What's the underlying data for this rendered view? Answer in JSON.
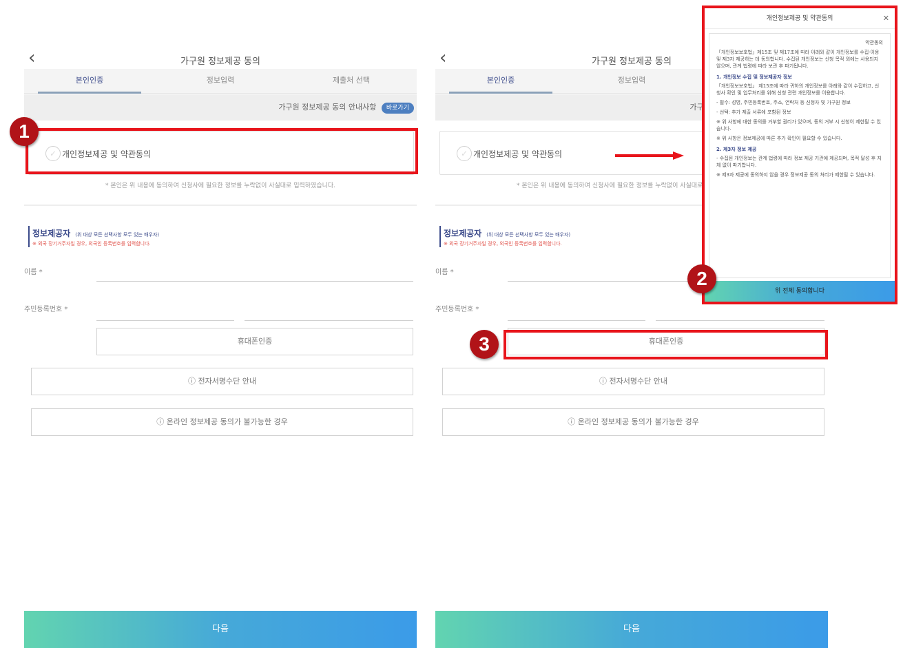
{
  "screen": {
    "back_icon": "chevron-left-icon",
    "title": "가구원 정보제공 동의",
    "tabs": [
      "본인인증",
      "정보입력",
      "제출처 선택"
    ],
    "guide_text": "가구원 정보제공 동의 안내사항",
    "guide_badge": "바로가기",
    "agree_label": "개인정보제공 및 약관동의",
    "notice": "* 본인은 위 내용에 동의하여 신청사에 필요한 정보를 누락없이 사실대로 입력하였습니다.",
    "info_title": "정보제공자",
    "info_sub": "(위 대상 모든 선택사항 모두 있는 배우자)",
    "info_warn": "※ 외국 장기거주자일 경우, 외국인 등록번호를 입력합니다.",
    "name_label": "이름 *",
    "rrn_label": "주민등록번호 *",
    "name_value": "",
    "rrn_front": "",
    "rrn_back": "",
    "verify_button": "휴대폰인증",
    "guide_button_1": "ⓘ 전자서명수단 안내",
    "guide_button_2": "ⓘ 온라인 정보제공 동의가 불가능한 경우",
    "next_button": "다음"
  },
  "modal": {
    "title": "개인정보제공 및 약관동의",
    "close_icon": "close-icon",
    "top_right_label": "약관동의",
    "intro": "「개인정보보호법」제15조 및 제17조에 따라 아래와 같이 개인정보를 수집·이용 및 제3자 제공하는 데 동의합니다. 수집된 개인정보는 신청 목적 외에는 사용되지 않으며, 관계 법령에 따라 보관 후 파기됩니다.",
    "section_1_title": "1. 개인정보 수집 및 정보제공자 정보",
    "section_1_text": "「개인정보보호법」 제15조에 따라 귀하의 개인정보를 아래와 같이 수집하고, 신청사 확인 및 업무처리를 위해 신청 관련 개인정보를 이용합니다.",
    "bullet_1": "- 필수: 성명, 주민등록번호, 주소, 연락처 등 신청자 및 가구원 정보",
    "bullet_2": "- 선택: 추가 제출 서류에 포함된 정보",
    "note_1": "※ 위 사항에 대한 동의를 거부할 권리가 있으며, 동의 거부 시 신청이 제한될 수 있습니다.",
    "note_2": "※ 위 사항은 정보제공에 따른 추가 확인이 필요할 수 있습니다.",
    "section_2_title": "2. 제3자 정보 제공",
    "section_2_text": "- 수집된 개인정보는 관계 법령에 따라 정보 제공 기관에 제공되며, 목적 달성 후 지체 없이 파기합니다.",
    "note_3": "※ 제3자 제공에 동의하지 않을 경우 정보제공 동의 처리가 제한될 수 있습니다.",
    "agree_button": "위 전체 동의합니다"
  },
  "annotations": {
    "badge_1": "1",
    "badge_2": "2",
    "badge_3": "3",
    "highlight_color": "#e8141b",
    "badge_color": "#b11318",
    "arrow_icon": "arrow-right-icon"
  },
  "colors": {
    "accent_navy": "#3b4a8a",
    "warn_red": "#e0514a",
    "gradient_start": "#62d4b0",
    "gradient_end": "#3b9be8"
  }
}
